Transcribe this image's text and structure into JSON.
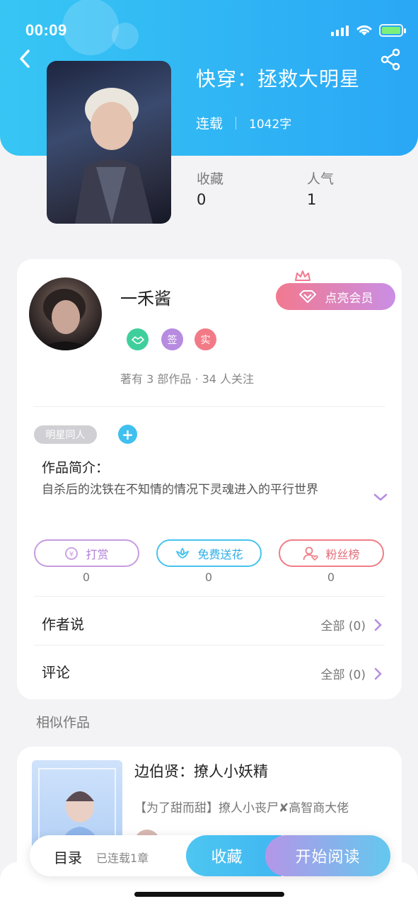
{
  "status_bar": {
    "time": "00:09"
  },
  "book": {
    "title": "快穿：拯救大明星",
    "status": "连载",
    "word_count": "1042字",
    "stats": [
      {
        "label": "收藏",
        "value": "0"
      },
      {
        "label": "人气",
        "value": "1"
      }
    ]
  },
  "author": {
    "name": "一禾酱",
    "vip_button": "点亮会员",
    "badges": [
      "签",
      "实"
    ],
    "follow_info": "著有 3 部作品 · 34 人关注"
  },
  "tag": "明星同人",
  "intro": {
    "label": "作品简介：",
    "text": "自杀后的沈铁在不知情的情况下灵魂进入的平行世界"
  },
  "actions": [
    {
      "label": "打赏",
      "count": "0",
      "color": "#c79be0"
    },
    {
      "label": "免费送花",
      "count": "0",
      "color": "#47c3ef"
    },
    {
      "label": "粉丝榜",
      "count": "0",
      "color": "#ef7d86"
    }
  ],
  "rows": [
    {
      "label": "作者说",
      "right": "全部 (0)"
    },
    {
      "label": "评论",
      "right": "全部 (0)"
    }
  ],
  "similar": {
    "section_label": "相似作品",
    "title": "边伯贤：撩人小妖精",
    "desc": "【为了甜而甜】撩人小丧尸✘高智商大佬"
  },
  "bottom_bar": {
    "toc": "目录",
    "chapters": "已连载1章",
    "collect": "收藏",
    "read": "开始阅读"
  },
  "colors": {
    "header": "#2fb1f5",
    "accent_purple": "#b496e7",
    "accent_blue": "#3fb7f1"
  }
}
